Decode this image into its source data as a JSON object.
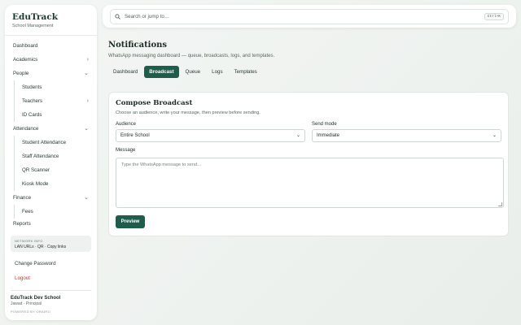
{
  "brand": {
    "name": "EduTrack",
    "subtitle": "School Management"
  },
  "sidebar": {
    "dashboard": "Dashboard",
    "academics": "Academics",
    "people": "People",
    "people_items": [
      "Students",
      "Teachers",
      "ID Cards"
    ],
    "attendance": "Attendance",
    "attendance_items": [
      "Student Attendance",
      "Staff Attendance",
      "QR Scanner",
      "Kiosk Mode"
    ],
    "finance": "Finance",
    "finance_items": [
      "Fees"
    ],
    "reports": "Reports"
  },
  "network": {
    "title": "NETWORK INFO",
    "text": "LAN URLs · QR · Copy links"
  },
  "links": {
    "change_password": "Change Password",
    "logout": "Logout"
  },
  "school": {
    "name": "EduTrack Dev School",
    "user": "Jawad · Principal",
    "powered": "POWERED BY ORAIRO"
  },
  "search": {
    "placeholder": "Search or jump to…",
    "shortcut": "Ctrl+K"
  },
  "page": {
    "title": "Notifications",
    "subtitle": "WhatsApp messaging dashboard — queue, broadcasts, logs, and templates."
  },
  "tabs": [
    "Dashboard",
    "Broadcast",
    "Queue",
    "Logs",
    "Templates"
  ],
  "active_tab": "Broadcast",
  "compose": {
    "title": "Compose Broadcast",
    "subtitle": "Choose an audience, write your message, then preview before sending.",
    "audience_label": "Audience",
    "audience_value": "Entire School",
    "send_mode_label": "Send mode",
    "send_mode_value": "Immediate",
    "message_label": "Message",
    "message_placeholder": "Type the WhatsApp message to send…",
    "preview_button": "Preview"
  },
  "colors": {
    "accent": "#1f5c4b",
    "logout": "#c0392b"
  }
}
